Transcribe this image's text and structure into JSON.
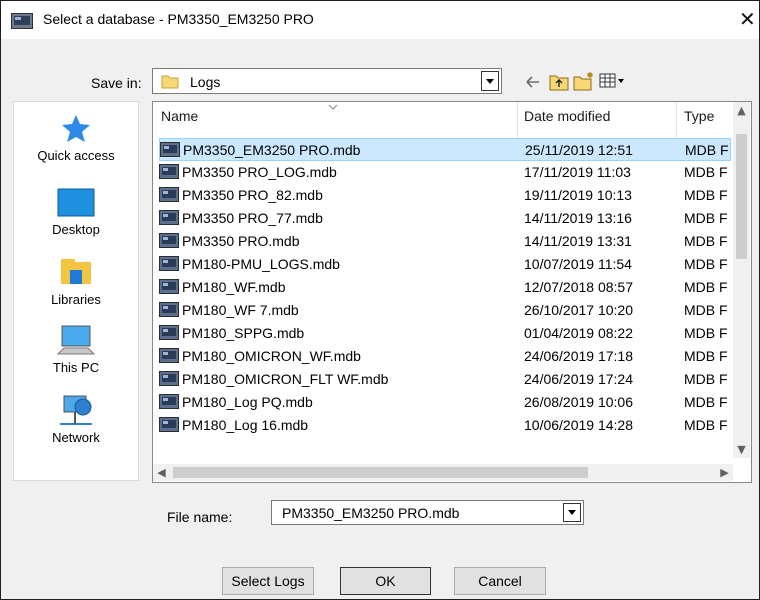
{
  "window": {
    "title": "Select a database - PM3350_EM3250 PRO",
    "close_glyph": "✕"
  },
  "toolbar": {
    "save_in_label": "Save in:",
    "save_in_value": "Logs",
    "icons": [
      "back-arrow-icon",
      "up-folder-icon",
      "new-folder-icon",
      "view-menu-icon"
    ]
  },
  "places": [
    {
      "label": "Quick access",
      "icon": "star-icon"
    },
    {
      "label": "Desktop",
      "icon": "desktop-icon"
    },
    {
      "label": "Libraries",
      "icon": "libraries-icon"
    },
    {
      "label": "This PC",
      "icon": "computer-icon"
    },
    {
      "label": "Network",
      "icon": "network-icon"
    }
  ],
  "columns": {
    "name": "Name",
    "date": "Date modified",
    "type": "Type"
  },
  "files": [
    {
      "name": "PM3350_EM3250 PRO.mdb",
      "date": "25/11/2019 12:51",
      "type": "MDB F",
      "selected": true
    },
    {
      "name": "PM3350 PRO_LOG.mdb",
      "date": "17/11/2019 11:03",
      "type": "MDB F"
    },
    {
      "name": "PM3350 PRO_82.mdb",
      "date": "19/11/2019 10:13",
      "type": "MDB F"
    },
    {
      "name": "PM3350 PRO_77.mdb",
      "date": "14/11/2019 13:16",
      "type": "MDB F"
    },
    {
      "name": "PM3350 PRO.mdb",
      "date": "14/11/2019 13:31",
      "type": "MDB F"
    },
    {
      "name": "PM180-PMU_LOGS.mdb",
      "date": "10/07/2019 11:54",
      "type": "MDB F"
    },
    {
      "name": "PM180_WF.mdb",
      "date": "12/07/2018 08:57",
      "type": "MDB F"
    },
    {
      "name": "PM180_WF 7.mdb",
      "date": "26/10/2017 10:20",
      "type": "MDB F"
    },
    {
      "name": "PM180_SPPG.mdb",
      "date": "01/04/2019 08:22",
      "type": "MDB F"
    },
    {
      "name": "PM180_OMICRON_WF.mdb",
      "date": "24/06/2019 17:18",
      "type": "MDB F"
    },
    {
      "name": "PM180_OMICRON_FLT WF.mdb",
      "date": "24/06/2019 17:24",
      "type": "MDB F"
    },
    {
      "name": "PM180_Log PQ.mdb",
      "date": "26/08/2019 10:06",
      "type": "MDB F"
    },
    {
      "name": "PM180_Log 16.mdb",
      "date": "10/06/2019 14:28",
      "type": "MDB F"
    }
  ],
  "file_name": {
    "label": "File name:",
    "value": "PM3350_EM3250 PRO.mdb"
  },
  "buttons": {
    "select_logs": "Select Logs",
    "ok": "OK",
    "cancel": "Cancel"
  },
  "colors": {
    "selection": "#cce8ff",
    "selection_border": "#99d1ff",
    "face": "#f0f0f0"
  }
}
